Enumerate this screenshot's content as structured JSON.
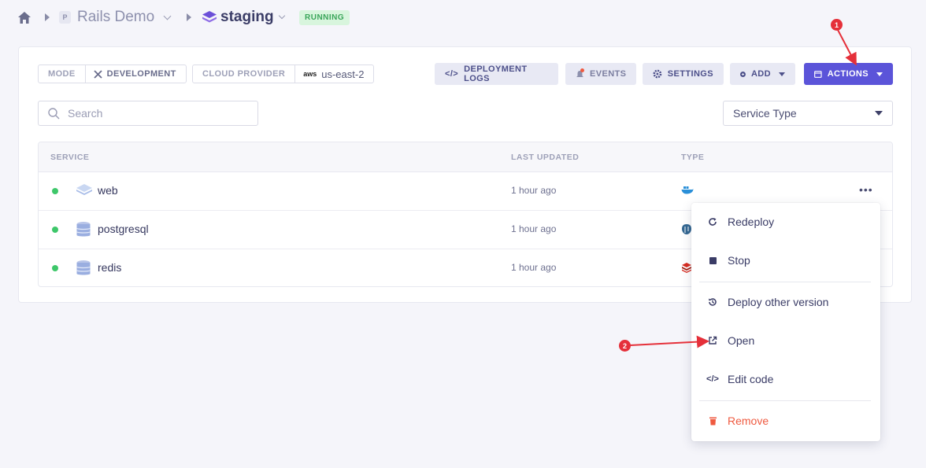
{
  "breadcrumb": {
    "project_badge": "P",
    "project_name": "Rails Demo",
    "environment_name": "staging",
    "status": "RUNNING"
  },
  "meta": {
    "mode_label": "MODE",
    "mode_value": "DEVELOPMENT",
    "cloud_label": "CLOUD PROVIDER",
    "cloud_brand": "aws",
    "cloud_value": "us-east-2"
  },
  "toolbar": {
    "deployment_logs": "DEPLOYMENT LOGS",
    "events": "EVENTS",
    "settings": "SETTINGS",
    "add": "ADD",
    "actions": "ACTIONS"
  },
  "search": {
    "placeholder": "Search"
  },
  "filter": {
    "service_type": "Service Type"
  },
  "table": {
    "headers": {
      "service": "SERVICE",
      "last_updated": "LAST UPDATED",
      "type": "TYPE"
    },
    "rows": [
      {
        "name": "web",
        "updated": "1 hour ago",
        "type_icon": "docker-icon"
      },
      {
        "name": "postgresql",
        "updated": "1 hour ago",
        "type_icon": "postgresql-icon"
      },
      {
        "name": "redis",
        "updated": "1 hour ago",
        "type_icon": "redis-icon"
      }
    ]
  },
  "menu": {
    "items": [
      {
        "label": "Redeploy",
        "icon": "redeploy-icon"
      },
      {
        "label": "Stop",
        "icon": "stop-icon"
      },
      {
        "label": "Deploy other version",
        "icon": "history-icon"
      },
      {
        "label": "Open",
        "icon": "external-link-icon"
      },
      {
        "label": "Edit code",
        "icon": "code-icon"
      },
      {
        "label": "Remove",
        "icon": "trash-icon"
      }
    ]
  },
  "annotations": {
    "one": "1",
    "two": "2"
  },
  "colors": {
    "primary": "#5b54d9",
    "running": "#3ec76a",
    "danger": "#ef5a40",
    "annotation": "#e5303a"
  }
}
